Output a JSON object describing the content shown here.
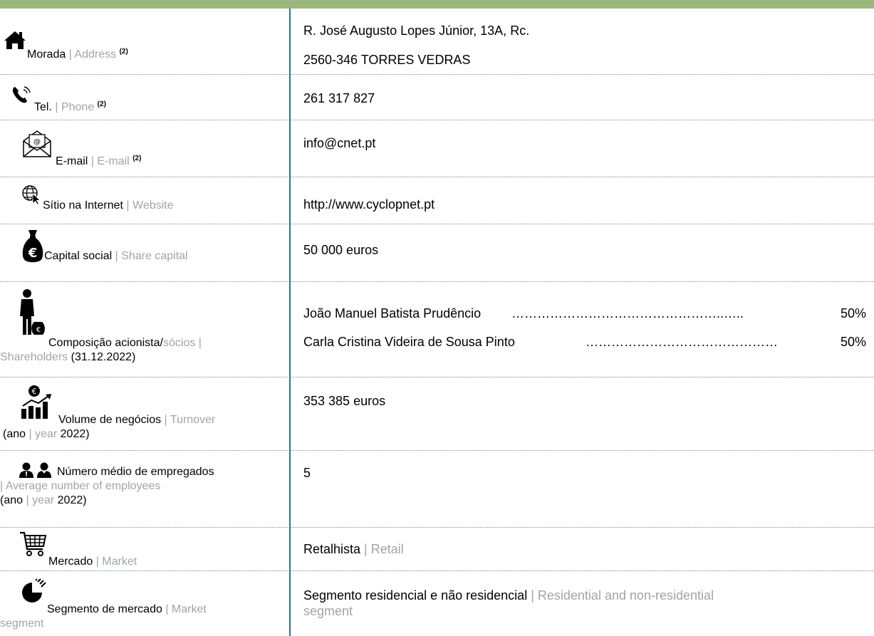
{
  "rows": {
    "address": {
      "label_pt": "Morada",
      "sep": " | ",
      "label_en": "Address",
      "note": "(2)",
      "line1": "R. José Augusto Lopes Júnior, 13A, Rc.",
      "line2": "2560-346 TORRES VEDRAS"
    },
    "phone": {
      "label_pt": "Tel.",
      "sep": " | ",
      "label_en": "Phone",
      "note": "(2)",
      "value": "261 317 827"
    },
    "email": {
      "label_pt": "E-mail",
      "sep": " | ",
      "label_en": "E-mail",
      "note": "(2)",
      "value": "info@cnet.pt"
    },
    "website": {
      "label_pt": "Sítio na Internet",
      "sep": " | ",
      "label_en": "Website",
      "value": "http://www.cyclopnet.pt"
    },
    "capital": {
      "label_pt": "Capital social",
      "sep": " | ",
      "label_en": "Share capital",
      "value": "50 000 euros"
    },
    "shareholders": {
      "label_pt": "Composição acionista/",
      "label_pt2": "sócios",
      "sep": " | ",
      "label_en": "Shareholders",
      "date": " (31.12.2022)",
      "list": [
        {
          "name": "João Manuel Batista Prudêncio",
          "dots": "…………………………………………..…..",
          "pct": "50%"
        },
        {
          "name": "Carla Cristina Videira de Sousa Pinto",
          "dots": "………………………………………",
          "pct": "50%"
        }
      ]
    },
    "turnover": {
      "label_pt": "Volume de negócios",
      "sep": " | ",
      "label_en": "Turnover",
      "year_pt": "(ano",
      "year_sep": " | ",
      "year_en": "year",
      "year_val": " 2022)",
      "value": "353 385 euros"
    },
    "employees": {
      "label_pt": "Número médio de empregados",
      "label_en": "| Average number of employees",
      "year_pt": "(ano",
      "year_sep": " | ",
      "year_en": "year",
      "year_val": " 2022)",
      "value": "5"
    },
    "market": {
      "label_pt": "Mercado",
      "sep": " | ",
      "label_en": "Market",
      "value_pt": "Retalhista",
      "value_sep": " | ",
      "value_en": "Retail"
    },
    "segment": {
      "label_pt": "Segmento de mercado",
      "sep": " | ",
      "label_en": "Market",
      "label_en2": "segment",
      "value_pt": "Segmento residencial e não residencial",
      "value_sep": " | ",
      "value_en": "Residential and non-residential",
      "value_en2": "segment"
    }
  },
  "colors": {
    "header_bar": "#9bb77f",
    "divider": "#2f6f97",
    "english_text": "#a0a4a8"
  },
  "icons": [
    "home-icon",
    "phone-icon",
    "email-icon",
    "globe-icon",
    "money-bag-icon",
    "shareholder-icon",
    "turnover-chart-icon",
    "employees-icon",
    "cart-icon",
    "pie-segment-icon"
  ]
}
